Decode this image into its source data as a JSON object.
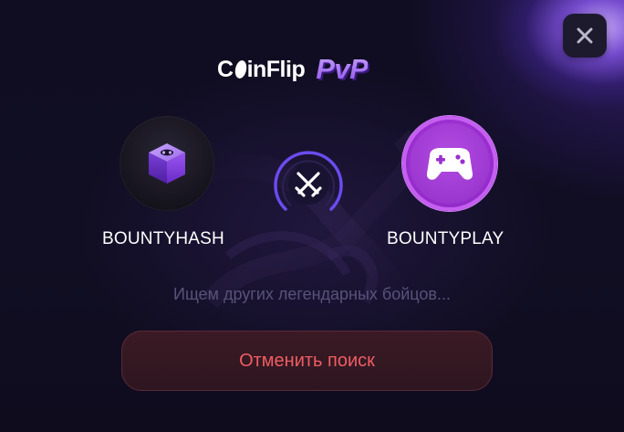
{
  "header": {
    "logo": {
      "text_before": "C",
      "text_after": "inFlip",
      "badge": "PvP"
    },
    "close_icon": "close-icon"
  },
  "players": {
    "left": {
      "name": "BOUNTYHASH",
      "avatar_icon": "cube-icon"
    },
    "right": {
      "name": "BOUNTYPLAY",
      "avatar_icon": "gamepad-icon"
    }
  },
  "versus": {
    "icon": "crossed-swords-icon"
  },
  "status": {
    "text": "Ищем других легендарных бойцов..."
  },
  "actions": {
    "cancel_label": "Отменить поиск"
  },
  "colors": {
    "accent": "#8b4fe8",
    "cancel_text": "#ef5d64",
    "cancel_bg": "#3a1a24",
    "status_text": "#57537a",
    "right_avatar": "#a23ad8"
  }
}
